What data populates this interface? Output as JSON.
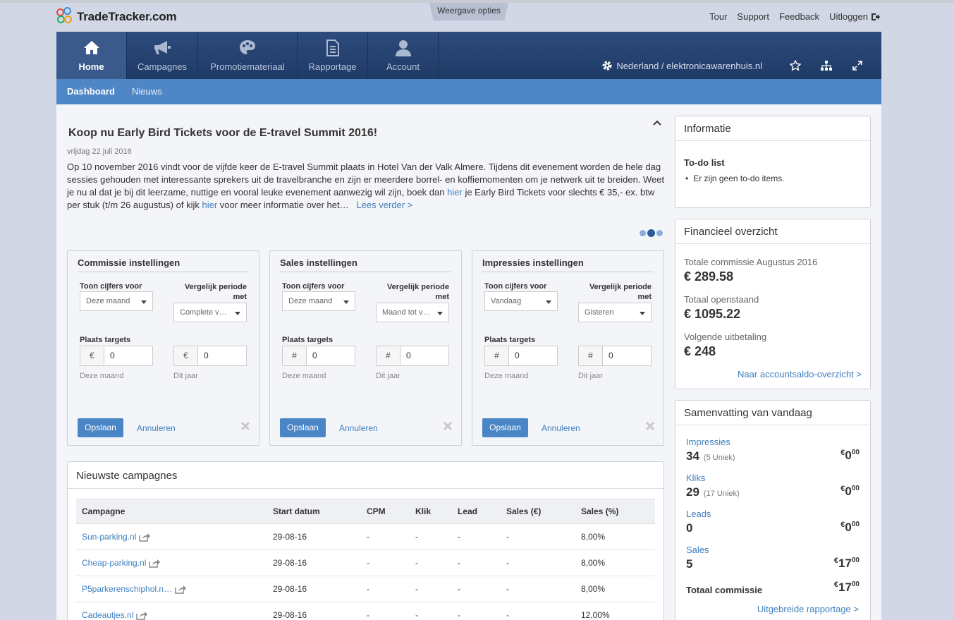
{
  "brand": {
    "name": "TradeTracker.com"
  },
  "topbar": {
    "view_options": "Weergave opties",
    "links": [
      "Tour",
      "Support",
      "Feedback",
      "Uitloggen"
    ]
  },
  "nav": {
    "tabs": [
      {
        "label": "Home",
        "icon": "home-icon",
        "active": true
      },
      {
        "label": "Campagnes",
        "icon": "megaphone-icon",
        "active": false
      },
      {
        "label": "Promotiemateriaal",
        "icon": "palette-icon",
        "active": false
      },
      {
        "label": "Rapportage",
        "icon": "document-icon",
        "active": false
      },
      {
        "label": "Account",
        "icon": "user-icon",
        "active": false
      }
    ],
    "site": "Nederland / elektronicawarenhuis.nl"
  },
  "subnav": {
    "items": [
      "Dashboard",
      "Nieuws"
    ]
  },
  "news": {
    "title": "Koop nu Early Bird Tickets voor de E-travel Summit 2016!",
    "date": "vrijdag 22 juli 2016",
    "body_1": "Op 10 november 2016 vindt voor de vijfde keer de E-travel Summit plaats in Hotel Van der Valk Almere. Tijdens dit evenement worden de hele dag sessies gehouden met interessante sprekers uit de travelbranche en zijn er meerdere borrel- en koffiemomenten om je netwerk uit te breiden. Weet je nu al dat je bij dit leerzame, nuttige en vooral leuke evenement aanwezig wil zijn, boek dan",
    "link_1": "hier",
    "body_2": "je Early Bird Tickets voor slechts € 35,- ex. btw per stuk (t/m 26 augustus) of kijk",
    "link_2": "hier",
    "body_3": "voor meer informatie over het…",
    "read_more": "Lees verder >"
  },
  "panels": [
    {
      "title": "Commissie instellingen",
      "show_label": "Toon cijfers voor",
      "compare_label": "Vergelijk periode met",
      "show_value": "Deze maand",
      "compare_value": "Complete vorige maand",
      "targets_label": "Plaats targets",
      "prefix": "€",
      "target_month": "0",
      "target_year": "0",
      "hint_month": "Deze maand",
      "hint_year": "Dit jaar",
      "save": "Opslaan",
      "cancel": "Annuleren"
    },
    {
      "title": "Sales instellingen",
      "show_label": "Toon cijfers voor",
      "compare_label": "Vergelijk periode met",
      "show_value": "Deze maand",
      "compare_value": "Maand tot vandaag",
      "targets_label": "Plaats targets",
      "prefix": "#",
      "target_month": "0",
      "target_year": "0",
      "hint_month": "Deze maand",
      "hint_year": "Dit jaar",
      "save": "Opslaan",
      "cancel": "Annuleren"
    },
    {
      "title": "Impressies instellingen",
      "show_label": "Toon cijfers voor",
      "compare_label": "Vergelijk periode met",
      "show_value": "Vandaag",
      "compare_value": "Gisteren",
      "targets_label": "Plaats targets",
      "prefix": "#",
      "target_month": "0",
      "target_year": "0",
      "hint_month": "Deze maand",
      "hint_year": "Dit jaar",
      "save": "Opslaan",
      "cancel": "Annuleren"
    }
  ],
  "campaigns": {
    "title": "Nieuwste campagnes",
    "columns": [
      "Campagne",
      "Start datum",
      "CPM",
      "Klik",
      "Lead",
      "Sales (€)",
      "Sales (%)"
    ],
    "rows": [
      [
        "Sun-parking.nl",
        "29-08-16",
        "-",
        "-",
        "-",
        "-",
        "8,00%"
      ],
      [
        "Cheap-parking.nl",
        "29-08-16",
        "-",
        "-",
        "-",
        "-",
        "8,00%"
      ],
      [
        "P5parkerenschiphol.n…",
        "29-08-16",
        "-",
        "-",
        "-",
        "-",
        "8,00%"
      ],
      [
        "Cadeautjes.nl",
        "29-08-16",
        "-",
        "-",
        "-",
        "-",
        "12,00%"
      ]
    ]
  },
  "info": {
    "title": "Informatie",
    "todo_title": "To-do list",
    "todo_empty": "Er zijn geen to-do items."
  },
  "finance": {
    "title": "Financieel overzicht",
    "items": [
      {
        "label": "Totale commissie Augustus 2016",
        "value": "€ 289.58"
      },
      {
        "label": "Totaal openstaand",
        "value": "€ 1095.22"
      },
      {
        "label": "Volgende uitbetaling",
        "value": "€ 248"
      }
    ],
    "link": "Naar accountsaldo-overzicht >"
  },
  "summary": {
    "title": "Samenvatting van vandaag",
    "items": [
      {
        "label": "Impressies",
        "value": "34",
        "unique": "(5 Uniek)",
        "cur": "€",
        "amount": "0",
        "cents": "00"
      },
      {
        "label": "Kliks",
        "value": "29",
        "unique": "(17 Uniek)",
        "cur": "€",
        "amount": "0",
        "cents": "00"
      },
      {
        "label": "Leads",
        "value": "0",
        "unique": "",
        "cur": "€",
        "amount": "0",
        "cents": "00"
      },
      {
        "label": "Sales",
        "value": "5",
        "unique": "",
        "cur": "€",
        "amount": "17",
        "cents": "00"
      }
    ],
    "total_label": "Totaal commissie",
    "total_cur": "€",
    "total_amount": "17",
    "total_cents": "00",
    "link": "Uitgebreide rapportage >"
  }
}
